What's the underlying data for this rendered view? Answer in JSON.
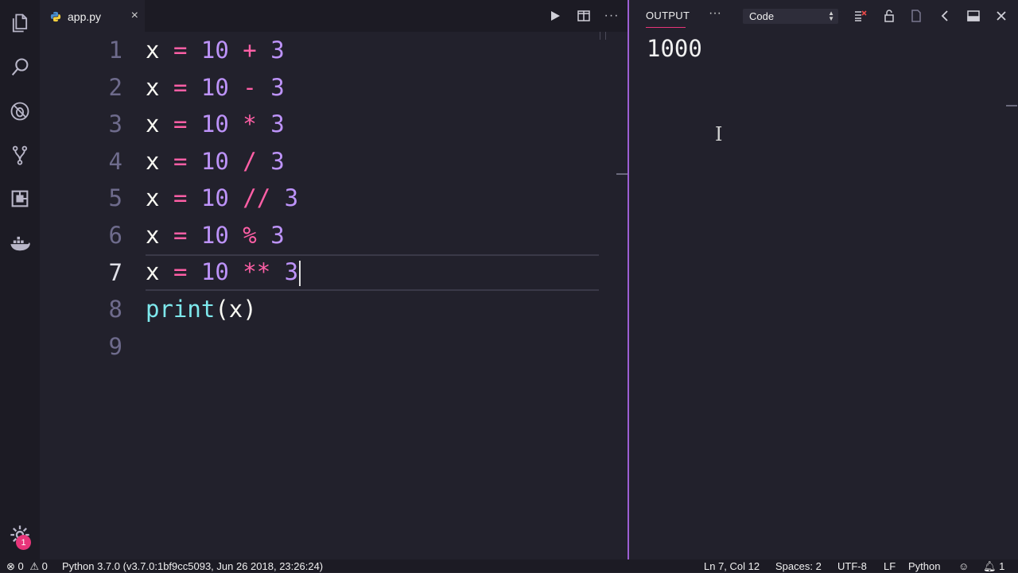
{
  "tab": {
    "label": "app.py",
    "close": "×"
  },
  "editor": {
    "lines": [
      {
        "num": "1",
        "tokens": [
          [
            "x",
            "var"
          ],
          [
            " ",
            "var"
          ],
          [
            "=",
            "op"
          ],
          [
            " ",
            "var"
          ],
          [
            "10",
            "num"
          ],
          [
            " ",
            "var"
          ],
          [
            "+",
            "op"
          ],
          [
            " ",
            "var"
          ],
          [
            "3",
            "num"
          ]
        ]
      },
      {
        "num": "2",
        "tokens": [
          [
            "x",
            "var"
          ],
          [
            " ",
            "var"
          ],
          [
            "=",
            "op"
          ],
          [
            " ",
            "var"
          ],
          [
            "10",
            "num"
          ],
          [
            " ",
            "var"
          ],
          [
            "-",
            "op"
          ],
          [
            " ",
            "var"
          ],
          [
            "3",
            "num"
          ]
        ]
      },
      {
        "num": "3",
        "tokens": [
          [
            "x",
            "var"
          ],
          [
            " ",
            "var"
          ],
          [
            "=",
            "op"
          ],
          [
            " ",
            "var"
          ],
          [
            "10",
            "num"
          ],
          [
            " ",
            "var"
          ],
          [
            "*",
            "op"
          ],
          [
            " ",
            "var"
          ],
          [
            "3",
            "num"
          ]
        ]
      },
      {
        "num": "4",
        "tokens": [
          [
            "x",
            "var"
          ],
          [
            " ",
            "var"
          ],
          [
            "=",
            "op"
          ],
          [
            " ",
            "var"
          ],
          [
            "10",
            "num"
          ],
          [
            " ",
            "var"
          ],
          [
            "/",
            "op"
          ],
          [
            " ",
            "var"
          ],
          [
            "3",
            "num"
          ]
        ]
      },
      {
        "num": "5",
        "tokens": [
          [
            "x",
            "var"
          ],
          [
            " ",
            "var"
          ],
          [
            "=",
            "op"
          ],
          [
            " ",
            "var"
          ],
          [
            "10",
            "num"
          ],
          [
            " ",
            "var"
          ],
          [
            "//",
            "op"
          ],
          [
            " ",
            "var"
          ],
          [
            "3",
            "num"
          ]
        ]
      },
      {
        "num": "6",
        "tokens": [
          [
            "x",
            "var"
          ],
          [
            " ",
            "var"
          ],
          [
            "=",
            "op"
          ],
          [
            " ",
            "var"
          ],
          [
            "10",
            "num"
          ],
          [
            " ",
            "var"
          ],
          [
            "%",
            "op"
          ],
          [
            " ",
            "var"
          ],
          [
            "3",
            "num"
          ]
        ]
      },
      {
        "num": "7",
        "tokens": [
          [
            "x",
            "var"
          ],
          [
            " ",
            "var"
          ],
          [
            "=",
            "op"
          ],
          [
            " ",
            "var"
          ],
          [
            "10",
            "num"
          ],
          [
            " ",
            "var"
          ],
          [
            "**",
            "op"
          ],
          [
            " ",
            "var"
          ],
          [
            "3",
            "num"
          ]
        ],
        "current": true
      },
      {
        "num": "8",
        "tokens": [
          [
            "print",
            "fn"
          ],
          [
            "(",
            "paren"
          ],
          [
            "x",
            "var"
          ],
          [
            ")",
            "paren"
          ]
        ]
      },
      {
        "num": "9",
        "tokens": []
      }
    ]
  },
  "panel": {
    "title": "OUTPUT",
    "more": "···",
    "channel": "Code",
    "output": "1000"
  },
  "status": {
    "errors": "0",
    "warnings": "0",
    "interpreter": "Python 3.7.0 (v3.7.0:1bf9cc5093, Jun 26 2018, 23:26:24)",
    "position": "Ln 7, Col 12",
    "spaces": "Spaces: 2",
    "encoding": "UTF-8",
    "eol": "LF",
    "language": "Python",
    "notifications": "1"
  },
  "activity": {
    "settings_badge": "1"
  },
  "colors": {
    "accent": "#e8357a",
    "divider": "#9d5fd4",
    "background": "#22212c"
  }
}
